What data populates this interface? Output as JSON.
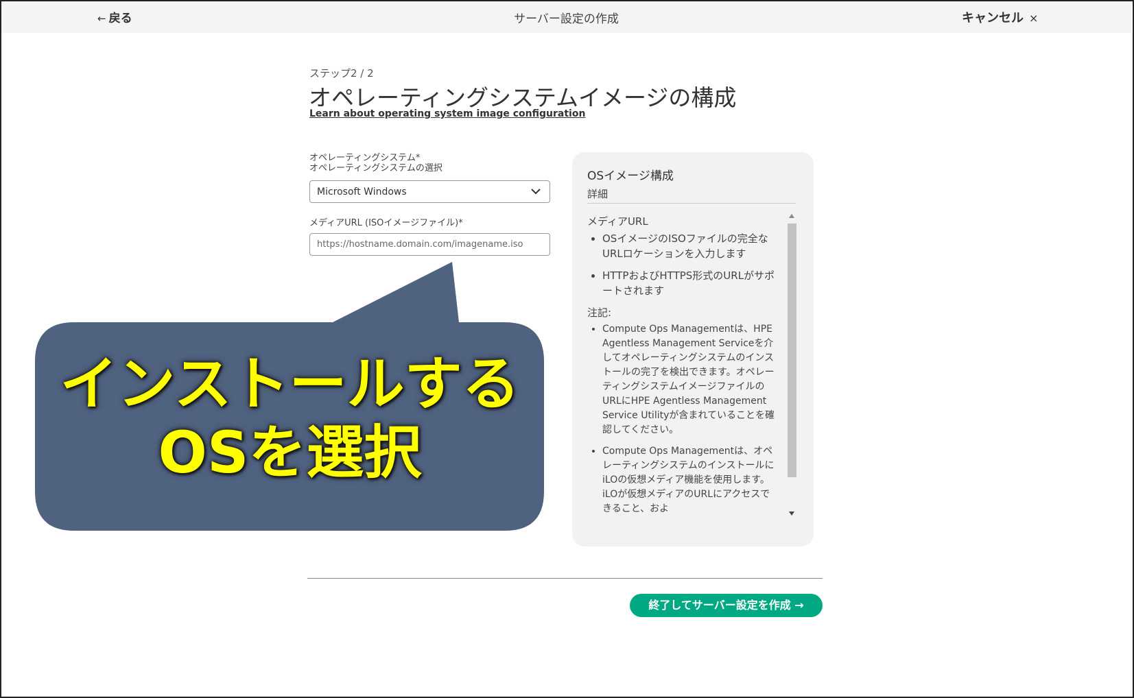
{
  "header": {
    "back_label": "戻る",
    "back_arrow": "←",
    "title": "サーバー設定の作成",
    "cancel_label": "キャンセル",
    "cancel_icon": "×"
  },
  "step": {
    "indicator": "ステップ2 / 2",
    "title": "オペレーティングシステムイメージの構成",
    "learn_link": "Learn about operating system image configuration"
  },
  "form": {
    "os_label_line1": "オペレーティングシステム*",
    "os_label_line2": "オペレーティングシステムの選択",
    "os_selected": "Microsoft Windows",
    "url_label": "メディアURL (ISOイメージファイル)*",
    "url_placeholder": "https://hostname.domain.com/imagename.iso"
  },
  "panel": {
    "title": "OSイメージ構成",
    "subtitle": "詳細",
    "media_heading": "メディアURL",
    "media_items": [
      "OSイメージのISOファイルの完全なURLロケーションを入力します",
      "HTTPおよびHTTPS形式のURLがサポートされます"
    ],
    "notes_heading": "注記:",
    "notes_items": [
      "Compute Ops Managementは、HPE Agentless Management Serviceを介してオペレーティングシステムのインストールの完了を検出できます。オペレーティングシステムイメージファイルのURLにHPE Agentless Management Service Utilityが含まれていることを確認してください。",
      "Compute Ops Managementは、オペレーティングシステムのインストールにiLOの仮想メディア機能を使用します。iLOが仮想メディアのURLにアクセスできること、およ"
    ]
  },
  "footer": {
    "finish_label": "終了してサーバー設定を作成 →"
  },
  "callout": {
    "line1": "インストールする",
    "line2": "OSを選択",
    "bg_color": "#4f6280",
    "text_color": "#ffff00"
  },
  "colors": {
    "accent": "#01a982",
    "header_bg": "#f4f4f4",
    "panel_bg": "#f2f2f2"
  }
}
